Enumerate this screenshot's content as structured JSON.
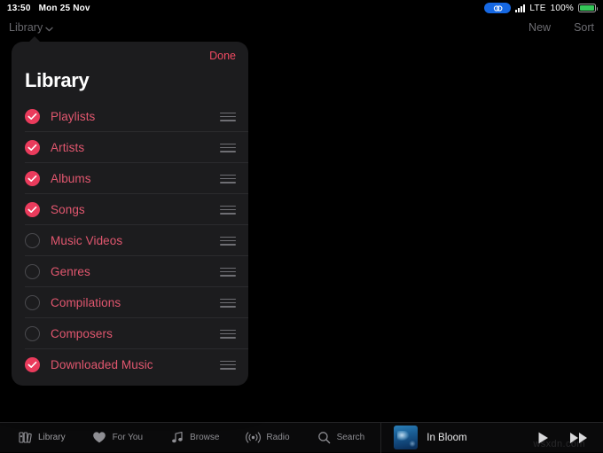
{
  "status_bar": {
    "time": "13:50",
    "date": "Mon 25 Nov",
    "badge_icon": "screen-mirroring-icon",
    "signal_icon": "cellular-signal-icon",
    "carrier": "LTE",
    "battery_percent": "100%",
    "battery_icon": "battery-full-icon"
  },
  "nav_bar": {
    "library_button": "Library",
    "chevron_icon": "chevron-down-icon",
    "new_button": "New",
    "sort_button": "Sort"
  },
  "popover": {
    "done_button": "Done",
    "title": "Library",
    "items": [
      {
        "label": "Playlists",
        "checked": true
      },
      {
        "label": "Artists",
        "checked": true
      },
      {
        "label": "Albums",
        "checked": true
      },
      {
        "label": "Songs",
        "checked": true
      },
      {
        "label": "Music Videos",
        "checked": false
      },
      {
        "label": "Genres",
        "checked": false
      },
      {
        "label": "Compilations",
        "checked": false
      },
      {
        "label": "Composers",
        "checked": false
      },
      {
        "label": "Downloaded Music",
        "checked": true
      }
    ]
  },
  "tab_bar": [
    {
      "label": "Library",
      "icon": "library-icon",
      "active": true
    },
    {
      "label": "For You",
      "icon": "heart-icon",
      "active": false
    },
    {
      "label": "Browse",
      "icon": "music-note-icon",
      "active": false
    },
    {
      "label": "Radio",
      "icon": "radio-broadcast-icon",
      "active": false
    },
    {
      "label": "Search",
      "icon": "search-icon",
      "active": false
    }
  ],
  "now_playing": {
    "artwork_icon": "album-artwork",
    "track_title": "In Bloom",
    "play_icon": "play-icon",
    "next_icon": "fast-forward-icon"
  },
  "watermark": "wsxdn.com",
  "colors": {
    "accent_pink": "#ea3b5c",
    "label_pink": "#e2576f",
    "panel": "#1c1c1e",
    "background": "#000000",
    "battery_green": "#35c759",
    "badge_blue": "#1668e3"
  }
}
